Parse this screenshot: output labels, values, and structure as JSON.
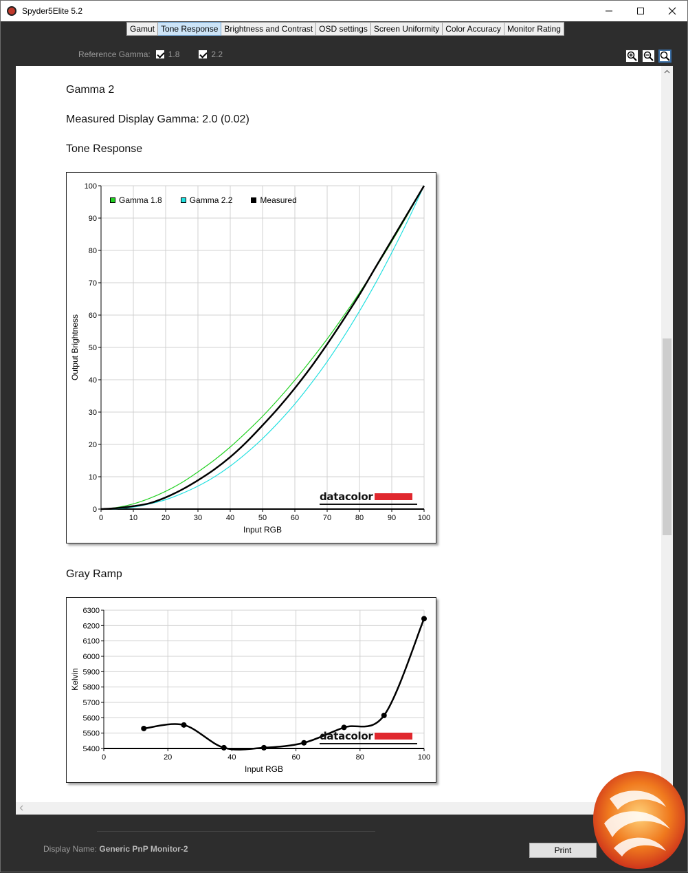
{
  "window": {
    "title": "Spyder5Elite 5.2"
  },
  "tabs": [
    "Gamut",
    "Tone Response",
    "Brightness and Contrast",
    "OSD settings",
    "Screen Uniformity",
    "Color Accuracy",
    "Monitor Rating"
  ],
  "active_tab": "Tone Response",
  "reference": {
    "label": "Reference Gamma:",
    "options": [
      "1.8",
      "2.2"
    ]
  },
  "report": {
    "heading1": "Gamma 2",
    "heading2": "Measured Display Gamma: 2.0 (0.02)",
    "heading3": "Tone Response",
    "heading4": "Gray Ramp"
  },
  "watermark": "datacolor",
  "footer": {
    "display_label": "Display Name:",
    "display_value": "Generic PnP Monitor-2",
    "print_label": "Print"
  },
  "chart_data": [
    {
      "type": "line",
      "title": "",
      "xlabel": "Input RGB",
      "ylabel": "Output Brightness",
      "xlim": [
        0,
        100
      ],
      "ylim": [
        0,
        100
      ],
      "xticks": [
        "0",
        "10",
        "20",
        "30",
        "40",
        "50",
        "60",
        "70",
        "80",
        "90",
        "100"
      ],
      "yticks": [
        "0",
        "10",
        "20",
        "30",
        "40",
        "50",
        "60",
        "70",
        "80",
        "90",
        "100"
      ],
      "grid": true,
      "legend_position": "top-left",
      "x": [
        0,
        5,
        10,
        15,
        20,
        25,
        30,
        35,
        40,
        45,
        50,
        55,
        60,
        65,
        70,
        75,
        80,
        85,
        90,
        95,
        100
      ],
      "series": [
        {
          "name": "Gamma 1.8",
          "color": "#22d122",
          "values": [
            0,
            0.5,
            1.6,
            3.3,
            5.5,
            8.2,
            11.5,
            15.1,
            19.2,
            23.8,
            28.7,
            34.1,
            39.9,
            46.1,
            52.6,
            59.6,
            66.9,
            74.6,
            82.7,
            91.2,
            100
          ]
        },
        {
          "name": "Gamma 2.2",
          "color": "#22e0e0",
          "values": [
            0,
            0.1,
            0.6,
            1.6,
            2.9,
            4.8,
            7.1,
            9.9,
            13.3,
            17.3,
            21.8,
            26.9,
            32.5,
            38.8,
            45.6,
            53.1,
            61.2,
            69.9,
            79.3,
            89.3,
            100
          ]
        },
        {
          "name": "Measured",
          "color": "#000000",
          "values": [
            0,
            0.3,
            0.9,
            1.8,
            3.6,
            6.0,
            8.9,
            12.2,
            16.1,
            20.7,
            25.9,
            31.4,
            37.4,
            43.9,
            51.0,
            58.5,
            66.3,
            74.8,
            83.2,
            91.6,
            100
          ]
        }
      ]
    },
    {
      "type": "line",
      "title": "",
      "xlabel": "Input RGB",
      "ylabel": "Kelvin",
      "xlim": [
        0,
        100
      ],
      "ylim": [
        5400,
        6300
      ],
      "xticks": [
        "0",
        "20",
        "40",
        "60",
        "80",
        "100"
      ],
      "yticks": [
        "5400",
        "5500",
        "5600",
        "5700",
        "5800",
        "5900",
        "6000",
        "6100",
        "6200",
        "6300"
      ],
      "grid": true,
      "x": [
        12.5,
        25,
        37.5,
        50,
        62.5,
        75,
        87.5,
        100
      ],
      "series": [
        {
          "color": "#000000",
          "values": [
            5530,
            5553,
            5405,
            5405,
            5437,
            5537,
            5615,
            6245
          ]
        }
      ]
    }
  ]
}
